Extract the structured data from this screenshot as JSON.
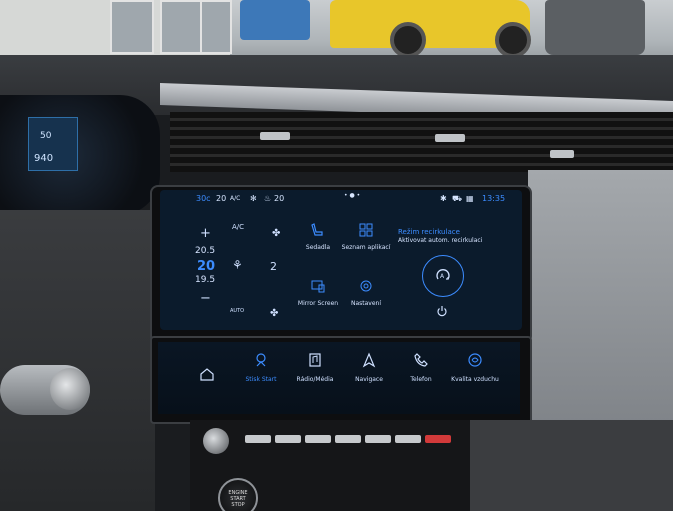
{
  "status_bar": {
    "temp_outside": "30c",
    "fan_level": "20",
    "ac_label": "A/C",
    "seat_heat": "20",
    "time": "13:35"
  },
  "climate": {
    "ac_mode": "A/C",
    "temp_up": "20.5",
    "temp_current": "20",
    "temp_down": "19.5",
    "fan_level": "2",
    "auto_label": "AUTO"
  },
  "tiles": {
    "sedadla": "Sedadla",
    "seznam": "Seznam aplikací",
    "mirror": "Mirror Screen",
    "nastaveni": "Nastavení"
  },
  "recirc": {
    "title": "Režim recirkulace",
    "subtitle": "Aktivovat autom. recirkulaci"
  },
  "nav": {
    "home": "",
    "drive": "Stisk Start",
    "radio": "Rádio/Média",
    "navigace": "Navigace",
    "telefon": "Telefon",
    "kvalita": "Kvalita vzduchu"
  },
  "cluster": {
    "range": "940",
    "value": "50"
  },
  "start_button": {
    "line1": "ENGINE",
    "line2": "START",
    "line3": "STOP"
  },
  "colors": {
    "accent": "#3c8cff",
    "screen_bg": "#0b1b2c"
  }
}
